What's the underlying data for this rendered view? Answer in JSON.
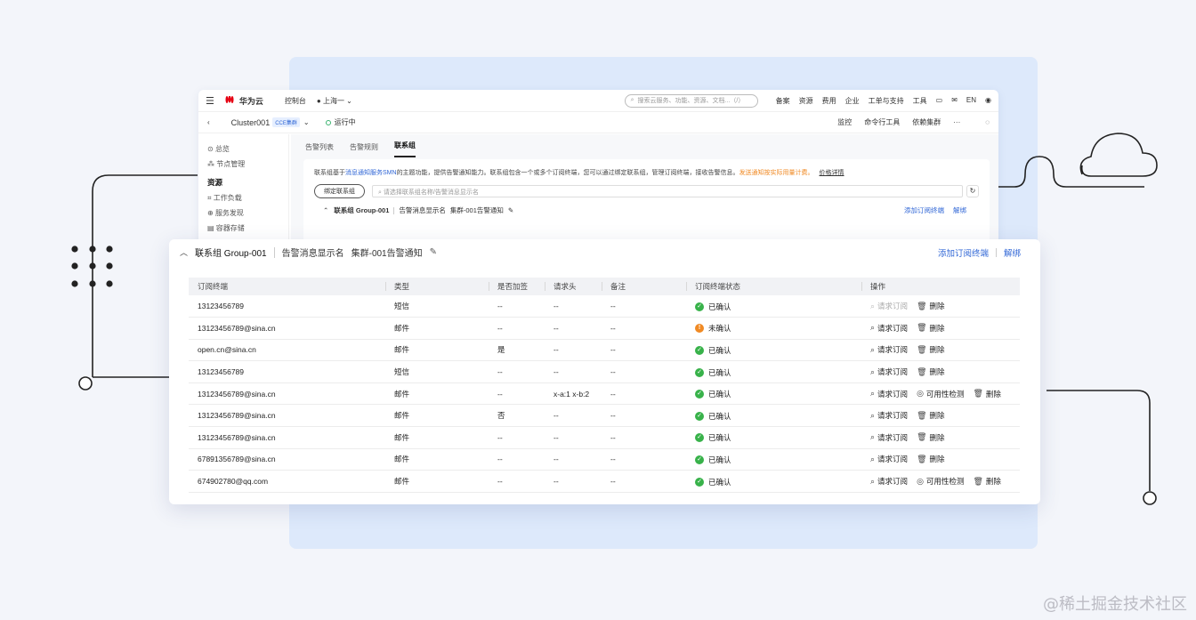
{
  "console": {
    "brand": "华为云",
    "nav_console": "控制台",
    "region": "上海一",
    "search_placeholder": "搜索云服务、功能、资源、文档...（/）",
    "top_links": [
      "备案",
      "资源",
      "费用",
      "企业",
      "工单与支持",
      "工具"
    ],
    "lang": "EN",
    "cluster_name": "Cluster001",
    "cluster_badge": "CCE集群",
    "run_status": "运行中",
    "cluster_actions": [
      "监控",
      "命令行工具",
      "依赖集群",
      "···"
    ],
    "side_items": [
      "总览",
      "节点管理"
    ],
    "side_section": "资源",
    "side_items2": [
      "工作负载",
      "服务发现",
      "容器存储"
    ],
    "tabs": [
      "告警列表",
      "告警规则",
      "联系组"
    ],
    "info_prefix": "联系组基于",
    "info_link": "消息通知服务SMN",
    "info_mid": "的主题功能，提供告警通知能力。联系组包含一个或多个订阅终端，您可以通过绑定联系组，管理订阅终端，接收告警信息。",
    "info_orange": "发送通知按实际用量计费。",
    "info_price": "价格详情",
    "bind_button": "绑定联系组",
    "group_search_placeholder": "请选择联系组名称/告警消息显示名",
    "mini_group_name": "联系组 Group-001",
    "mini_display_label": "告警消息显示名",
    "mini_display_value": "集群-001告警通知",
    "mini_add": "添加订阅终端",
    "mini_unbind": "解绑"
  },
  "card": {
    "group_name": "联系组 Group-001",
    "display_label": "告警消息显示名",
    "display_value": "集群-001告警通知",
    "add_terminal": "添加订阅终端",
    "unbind": "解绑",
    "columns": [
      "订阅终端",
      "类型",
      "是否加签",
      "请求头",
      "备注",
      "订阅终端状态",
      "操作"
    ],
    "rows": [
      {
        "terminal": "13123456789",
        "type": "短信",
        "sign": "--",
        "header": "--",
        "note": "--",
        "status": "已确认",
        "status_kind": "ok",
        "ops": [
          {
            "label": "请求订阅",
            "icon": "subscribe-icon",
            "disabled": true
          },
          {
            "label": "删除",
            "icon": "trash-icon"
          }
        ]
      },
      {
        "terminal": "13123456789@sina.cn",
        "type": "邮件",
        "sign": "--",
        "header": "--",
        "note": "--",
        "status": "未确认",
        "status_kind": "warn",
        "ops": [
          {
            "label": "请求订阅",
            "icon": "subscribe-icon"
          },
          {
            "label": "删除",
            "icon": "trash-icon"
          }
        ]
      },
      {
        "terminal": "open.cn@sina.cn",
        "type": "邮件",
        "sign": "是",
        "header": "--",
        "note": "--",
        "status": "已确认",
        "status_kind": "ok",
        "ops": [
          {
            "label": "请求订阅",
            "icon": "subscribe-icon"
          },
          {
            "label": "删除",
            "icon": "trash-icon"
          }
        ]
      },
      {
        "terminal": "13123456789",
        "type": "短信",
        "sign": "--",
        "header": "--",
        "note": "--",
        "status": "已确认",
        "status_kind": "ok",
        "ops": [
          {
            "label": "请求订阅",
            "icon": "subscribe-icon"
          },
          {
            "label": "删除",
            "icon": "trash-icon"
          }
        ]
      },
      {
        "terminal": "13123456789@sina.cn",
        "type": "邮件",
        "sign": "--",
        "header": "x-a:1 x-b:2",
        "note": "--",
        "status": "已确认",
        "status_kind": "ok",
        "ops": [
          {
            "label": "请求订阅",
            "icon": "subscribe-icon"
          },
          {
            "label": "可用性检测",
            "icon": "check-icon"
          },
          {
            "label": "删除",
            "icon": "trash-icon"
          }
        ]
      },
      {
        "terminal": "13123456789@sina.cn",
        "type": "邮件",
        "sign": "否",
        "header": "--",
        "note": "--",
        "status": "已确认",
        "status_kind": "ok",
        "ops": [
          {
            "label": "请求订阅",
            "icon": "subscribe-icon"
          },
          {
            "label": "删除",
            "icon": "trash-icon"
          }
        ]
      },
      {
        "terminal": "13123456789@sina.cn",
        "type": "邮件",
        "sign": "--",
        "header": "--",
        "note": "--",
        "status": "已确认",
        "status_kind": "ok",
        "ops": [
          {
            "label": "请求订阅",
            "icon": "subscribe-icon"
          },
          {
            "label": "删除",
            "icon": "trash-icon"
          }
        ]
      },
      {
        "terminal": "67891356789@sina.cn",
        "type": "邮件",
        "sign": "--",
        "header": "--",
        "note": "--",
        "status": "已确认",
        "status_kind": "ok",
        "ops": [
          {
            "label": "请求订阅",
            "icon": "subscribe-icon"
          },
          {
            "label": "删除",
            "icon": "trash-icon"
          }
        ]
      },
      {
        "terminal": "674902780@qq.com",
        "type": "邮件",
        "sign": "--",
        "header": "--",
        "note": "--",
        "status": "已确认",
        "status_kind": "ok",
        "ops": [
          {
            "label": "请求订阅",
            "icon": "subscribe-icon"
          },
          {
            "label": "可用性检测",
            "icon": "check-icon"
          },
          {
            "label": "删除",
            "icon": "trash-icon"
          }
        ]
      }
    ]
  },
  "watermark": "@稀土掘金技术社区",
  "colors": {
    "accent": "#3167d6",
    "ok": "#38b24a",
    "warn": "#f08a24",
    "panel": "#dde9fb"
  }
}
